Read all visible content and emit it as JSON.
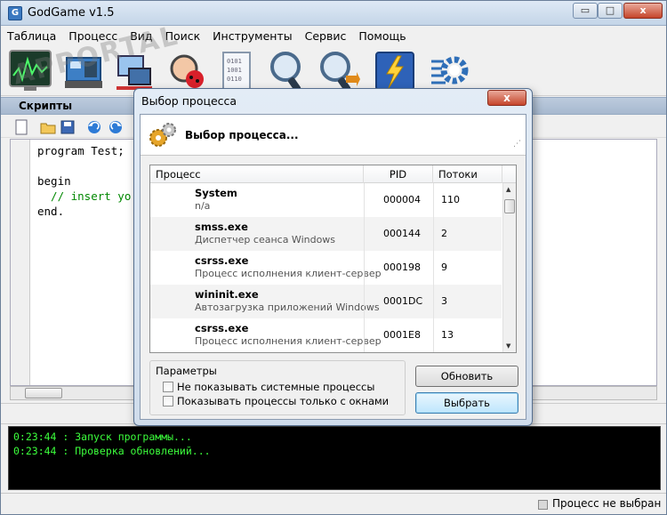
{
  "app": {
    "title": "GodGame v1.5",
    "icon_letter": "G",
    "controls": {
      "minimize": "▭",
      "maximize": "□",
      "close": "x"
    }
  },
  "watermark": "APPORTAL",
  "menu": [
    "Таблица",
    "Процесс",
    "Вид",
    "Поиск",
    "Инструменты",
    "Сервис",
    "Помощь"
  ],
  "toolbar_icons": [
    "chart-monitor-icon",
    "hardware-icon",
    "network-icon",
    "scan-icon",
    "document-icon",
    "search-icon",
    "search-arrow-icon",
    "lightning-icon",
    "settings-icon"
  ],
  "panel": {
    "title": "Скрипты"
  },
  "code_lines": [
    {
      "text": "program Test;",
      "comment": false
    },
    {
      "text": "",
      "comment": false
    },
    {
      "text": "begin",
      "comment": false
    },
    {
      "text": "  // insert yo",
      "comment": true
    },
    {
      "text": "end.",
      "comment": false
    }
  ],
  "log": [
    "0:23:44 : Запуск программы...",
    "0:23:44 : Проверка обновлений..."
  ],
  "status": {
    "text": "Процесс не выбран"
  },
  "dialog": {
    "title": "Выбор процесса",
    "close": "x",
    "header": "Выбор процесса...",
    "columns": {
      "process": "Процесс",
      "pid": "PID",
      "threads": "Потоки"
    },
    "processes": [
      {
        "name": "System",
        "desc": "n/a",
        "pid": "000004",
        "threads": "110"
      },
      {
        "name": "smss.exe",
        "desc": "Диспетчер сеанса  Windows",
        "pid": "000144",
        "threads": "2"
      },
      {
        "name": "csrss.exe",
        "desc": "Процесс исполнения клиент-сервер",
        "pid": "000198",
        "threads": "9"
      },
      {
        "name": "wininit.exe",
        "desc": "Автозагрузка приложений Windows",
        "pid": "0001DC",
        "threads": "3"
      },
      {
        "name": "csrss.exe",
        "desc": "Процесс исполнения клиент-сервер",
        "pid": "0001E8",
        "threads": "13"
      }
    ],
    "params": {
      "title": "Параметры",
      "hide_system": "Не показывать системные процессы",
      "only_windows": "Показывать процессы только с окнами"
    },
    "buttons": {
      "refresh": "Обновить",
      "select": "Выбрать"
    }
  }
}
